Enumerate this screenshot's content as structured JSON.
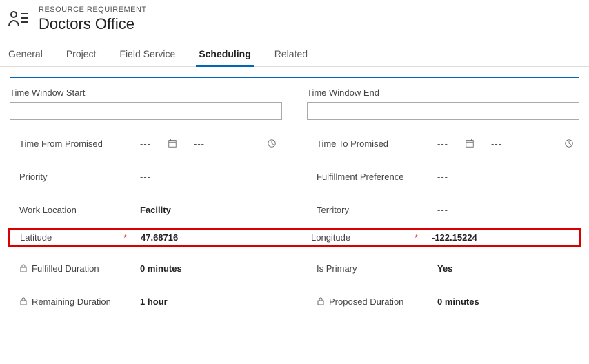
{
  "header": {
    "subtitle": "RESOURCE REQUIREMENT",
    "title": "Doctors Office"
  },
  "tabs": [
    {
      "label": "General"
    },
    {
      "label": "Project"
    },
    {
      "label": "Field Service"
    },
    {
      "label": "Scheduling",
      "active": true
    },
    {
      "label": "Related"
    }
  ],
  "sections": {
    "left_label": "Time Window Start",
    "right_label": "Time Window End"
  },
  "fields": {
    "time_from_promised": {
      "label": "Time From Promised",
      "date": "---",
      "time": "---"
    },
    "time_to_promised": {
      "label": "Time To Promised",
      "date": "---",
      "time": "---"
    },
    "priority": {
      "label": "Priority",
      "value": "---"
    },
    "fulfillment_preference": {
      "label": "Fulfillment Preference",
      "value": "---"
    },
    "work_location": {
      "label": "Work Location",
      "value": "Facility"
    },
    "territory": {
      "label": "Territory",
      "value": "---"
    },
    "latitude": {
      "label": "Latitude",
      "value": "47.68716"
    },
    "longitude": {
      "label": "Longitude",
      "value": "-122.15224"
    },
    "fulfilled_duration": {
      "label": "Fulfilled Duration",
      "value": "0 minutes"
    },
    "is_primary": {
      "label": "Is Primary",
      "value": "Yes"
    },
    "remaining_duration": {
      "label": "Remaining Duration",
      "value": "1 hour"
    },
    "proposed_duration": {
      "label": "Proposed Duration",
      "value": "0 minutes"
    }
  }
}
